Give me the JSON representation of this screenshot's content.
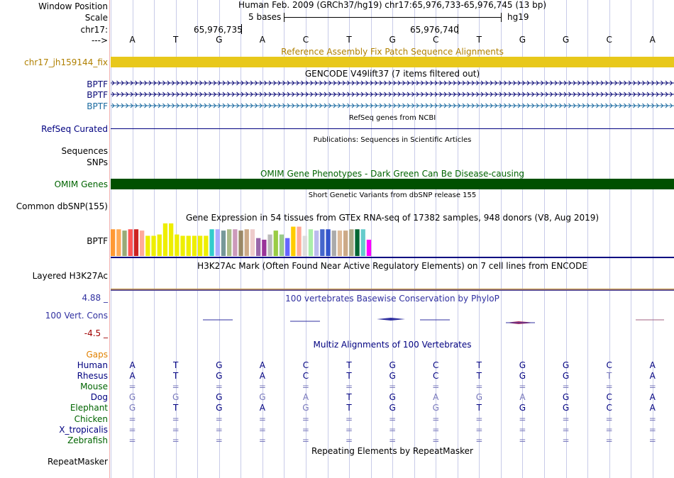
{
  "header": {
    "window_position_label": "Window Position",
    "scale_label": "Scale",
    "chrom_label": "chr17:",
    "arrow_label": "--->",
    "assembly_text": "Human Feb. 2009 (GRCh37/hg19)   chr17:65,976,733-65,976,745 (13 bp)",
    "scale_text": "5 bases",
    "genome_text": "hg19",
    "position_ticks": [
      "65,976,735",
      "65,976,740"
    ]
  },
  "bases": [
    "A",
    "T",
    "G",
    "A",
    "C",
    "T",
    "G",
    "C",
    "T",
    "G",
    "G",
    "C",
    "A"
  ],
  "tracks": {
    "fix_patch": {
      "title": "Reference Assembly Fix Patch Sequence Alignments",
      "label": "chr17_jh159144_fix"
    },
    "gencode": {
      "title": "GENCODE V49lift37 (7 items filtered out)",
      "labels": [
        "BPTF",
        "BPTF",
        "BPTF"
      ]
    },
    "refseq": {
      "title": "RefSeq genes from NCBI",
      "label": "RefSeq Curated"
    },
    "publications": {
      "title": "Publications: Sequences in Scientific Articles",
      "label_sequences": "Sequences",
      "label_snps": "SNPs"
    },
    "omim": {
      "title": "OMIM Gene Phenotypes - Dark Green Can Be Disease-causing",
      "label": "OMIM Genes"
    },
    "dbsnp": {
      "title": "Short Genetic Variants from dbSNP release 155",
      "label": "Common dbSNP(155)"
    },
    "gtex": {
      "title": "Gene Expression in 54 tissues from GTEx RNA-seq of 17382 samples, 948 donors (V8, Aug 2019)",
      "label": "BPTF",
      "bars": [
        {
          "v": 0.82,
          "c": "#ff9933"
        },
        {
          "v": 0.82,
          "c": "#ffaa55"
        },
        {
          "v": 0.78,
          "c": "#99aa77"
        },
        {
          "v": 0.82,
          "c": "#ff5555"
        },
        {
          "v": 0.82,
          "c": "#cc2222"
        },
        {
          "v": 0.78,
          "c": "#ffaa99"
        },
        {
          "v": 0.62,
          "c": "#eeee00"
        },
        {
          "v": 0.62,
          "c": "#eeee00"
        },
        {
          "v": 0.66,
          "c": "#eeee00"
        },
        {
          "v": 1.0,
          "c": "#eeee00"
        },
        {
          "v": 1.0,
          "c": "#eeee00"
        },
        {
          "v": 0.66,
          "c": "#eeee00"
        },
        {
          "v": 0.62,
          "c": "#eeee00"
        },
        {
          "v": 0.62,
          "c": "#eeee00"
        },
        {
          "v": 0.62,
          "c": "#eeee00"
        },
        {
          "v": 0.62,
          "c": "#eeee00"
        },
        {
          "v": 0.62,
          "c": "#eeee00"
        },
        {
          "v": 0.82,
          "c": "#33cccc"
        },
        {
          "v": 0.82,
          "c": "#aaaaff"
        },
        {
          "v": 0.78,
          "c": "#779999"
        },
        {
          "v": 0.82,
          "c": "#aabb88"
        },
        {
          "v": 0.82,
          "c": "#cc99bb"
        },
        {
          "v": 0.78,
          "c": "#998866"
        },
        {
          "v": 0.82,
          "c": "#ccaa88"
        },
        {
          "v": 0.82,
          "c": "#eecccc"
        },
        {
          "v": 0.55,
          "c": "#9966aa"
        },
        {
          "v": 0.5,
          "c": "#993399"
        },
        {
          "v": 0.66,
          "c": "#bbbbbb"
        },
        {
          "v": 0.78,
          "c": "#99cc44"
        },
        {
          "v": 0.66,
          "c": "#99cc88"
        },
        {
          "v": 0.55,
          "c": "#6666ff"
        },
        {
          "v": 0.9,
          "c": "#ffcc00"
        },
        {
          "v": 0.9,
          "c": "#ffaa99"
        },
        {
          "v": 0.62,
          "c": "#dddddd"
        },
        {
          "v": 0.82,
          "c": "#aaeeaa"
        },
        {
          "v": 0.78,
          "c": "#bbbbee"
        },
        {
          "v": 0.82,
          "c": "#4466cc"
        },
        {
          "v": 0.82,
          "c": "#3355cc"
        },
        {
          "v": 0.78,
          "c": "#aaaaaa"
        },
        {
          "v": 0.78,
          "c": "#ddbb99"
        },
        {
          "v": 0.78,
          "c": "#ccaa88"
        },
        {
          "v": 0.82,
          "c": "#aaaa88"
        },
        {
          "v": 0.82,
          "c": "#006633"
        },
        {
          "v": 0.82,
          "c": "#66cccc"
        },
        {
          "v": 0.5,
          "c": "#ff00ff"
        }
      ]
    },
    "h3k27ac": {
      "title": "H3K27Ac Mark (Often Found Near Active Regulatory Elements) on 7 cell lines from ENCODE",
      "label": "Layered H3K27Ac"
    },
    "phylop": {
      "title": "100 vertebrates Basewise Conservation by PhyloP",
      "label": "100 Vert. Cons",
      "max": "4.88 _",
      "min": "-4.5 _"
    },
    "multiz": {
      "title": "Multiz Alignments of 100 Vertebrates",
      "gaps_label": "Gaps",
      "species": [
        {
          "name": "Human",
          "color": "#000080",
          "seq": [
            "A",
            "T",
            "G",
            "A",
            "C",
            "T",
            "G",
            "C",
            "T",
            "G",
            "G",
            "C",
            "A"
          ]
        },
        {
          "name": "Rhesus",
          "color": "#000080",
          "seq": [
            "A",
            "T",
            "G",
            "A",
            "C",
            "T",
            "G",
            "C",
            "T",
            "G",
            "G",
            "T",
            "A"
          ]
        },
        {
          "name": "Mouse",
          "color": "#006400",
          "seq": [
            "=",
            "=",
            "=",
            "=",
            "=",
            "=",
            "=",
            "=",
            "=",
            "=",
            "=",
            "=",
            "="
          ]
        },
        {
          "name": "Dog",
          "color": "#000080",
          "seq": [
            "G",
            "G",
            "G",
            "G",
            "A",
            "T",
            "G",
            "A",
            "G",
            "A",
            "G",
            "C",
            "A"
          ]
        },
        {
          "name": "Elephant",
          "color": "#006400",
          "seq": [
            "G",
            "T",
            "G",
            "A",
            "G",
            "T",
            "G",
            "G",
            "T",
            "G",
            "G",
            "C",
            "A"
          ]
        },
        {
          "name": "Chicken",
          "color": "#006400",
          "seq": [
            "=",
            "=",
            "=",
            "=",
            "=",
            "=",
            "=",
            "=",
            "=",
            "=",
            "=",
            "=",
            "="
          ]
        },
        {
          "name": "X_tropicalis",
          "color": "#000080",
          "seq": [
            "=",
            "=",
            "=",
            "=",
            "=",
            "=",
            "=",
            "=",
            "=",
            "=",
            "=",
            "=",
            "="
          ]
        },
        {
          "name": "Zebrafish",
          "color": "#006400",
          "seq": [
            "=",
            "=",
            "=",
            "=",
            "=",
            "=",
            "=",
            "=",
            "=",
            "=",
            "=",
            "=",
            "="
          ]
        }
      ],
      "mismatch": [
        [
          0,
          0,
          0,
          0,
          0,
          0,
          0,
          0,
          0,
          0,
          0,
          0,
          0
        ],
        [
          0,
          0,
          0,
          0,
          0,
          0,
          0,
          0,
          0,
          0,
          0,
          1,
          0
        ],
        [
          1,
          1,
          1,
          1,
          1,
          1,
          1,
          1,
          1,
          1,
          1,
          1,
          1
        ],
        [
          1,
          1,
          0,
          1,
          1,
          0,
          0,
          1,
          1,
          1,
          0,
          0,
          0
        ],
        [
          1,
          0,
          0,
          0,
          1,
          0,
          0,
          1,
          0,
          0,
          0,
          0,
          0
        ],
        [
          1,
          1,
          1,
          1,
          1,
          1,
          1,
          1,
          1,
          1,
          1,
          1,
          1
        ],
        [
          1,
          1,
          1,
          1,
          1,
          1,
          1,
          1,
          1,
          1,
          1,
          1,
          1
        ],
        [
          1,
          1,
          1,
          1,
          1,
          1,
          1,
          1,
          1,
          1,
          1,
          1,
          1
        ]
      ]
    },
    "repeatmasker": {
      "title": "Repeating Elements by RepeatMasker",
      "label": "RepeatMasker"
    }
  },
  "colors": {
    "fix_patch": "#e8c81a",
    "omim": "#005000",
    "gencode": "#0c0c78",
    "gencode_light": "#1a6aa0",
    "navy": "#000080",
    "phylop": "#3030a0",
    "phylop_neg": "#a00000",
    "gaps": "#e08000",
    "green_label": "#006400",
    "olive_label": "#b08000",
    "mismatch": "#7777bb"
  }
}
